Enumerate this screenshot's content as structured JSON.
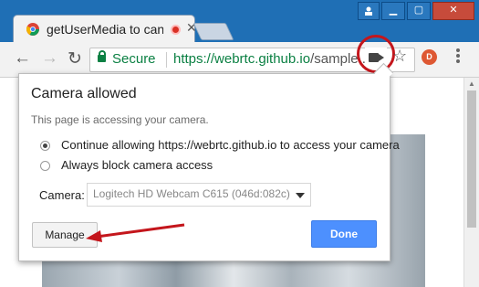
{
  "tab": {
    "title": "getUserMedia to canv"
  },
  "toolbar": {
    "secure_label": "Secure",
    "url_host": "https://webrtc.github.io",
    "url_rest": "/sample..."
  },
  "bubble": {
    "title": "Camera allowed",
    "description": "This page is accessing your camera.",
    "options": [
      {
        "label": "Continue allowing https://webrtc.github.io to access your camera",
        "selected": true
      },
      {
        "label": "Always block camera access",
        "selected": false
      }
    ],
    "camera_label": "Camera:",
    "camera_selected": "Logitech HD Webcam C615 (046d:082c)",
    "manage_label": "Manage",
    "done_label": "Done"
  },
  "colors": {
    "secure_green": "#0b8043",
    "done_blue": "#4d90fe",
    "annotation_red": "#c4161c",
    "titlebar_blue": "#1f6fb5"
  },
  "icons": [
    "chrome-favicon",
    "recording-dot-icon",
    "close-icon",
    "back-icon",
    "forward-icon",
    "reload-icon",
    "lock-icon",
    "camera-icon",
    "star-icon",
    "extension-icon",
    "menu-icon"
  ]
}
